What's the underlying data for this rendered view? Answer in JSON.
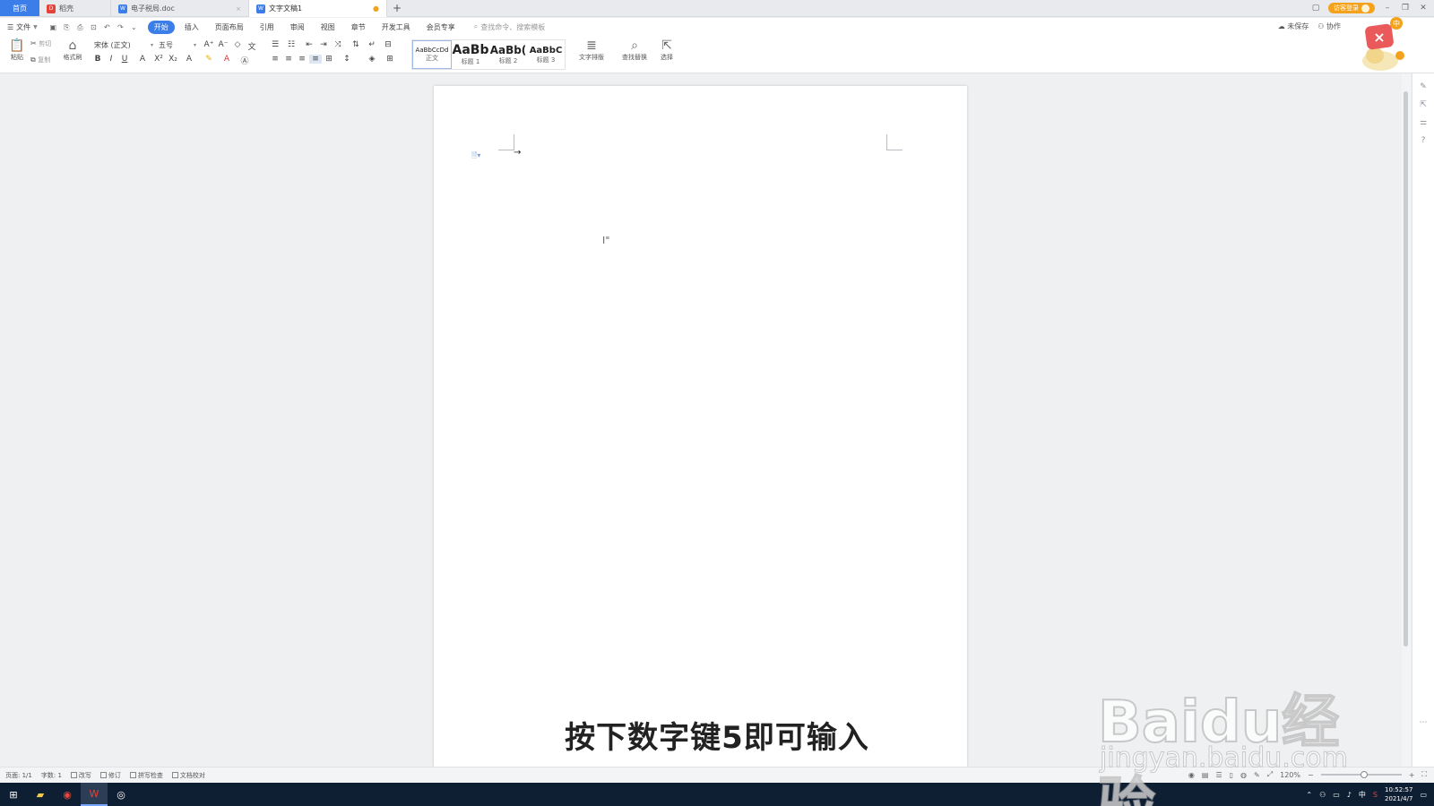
{
  "tabbar": {
    "home": "首页",
    "tabs": [
      {
        "label": "稻壳",
        "active": false
      },
      {
        "label": "电子税局.doc",
        "active": false
      },
      {
        "label": "文字文稿1",
        "active": true
      }
    ],
    "new_tab": "+",
    "login": "访客登录"
  },
  "menubar": {
    "file": "文件",
    "items": [
      "开始",
      "插入",
      "页面布局",
      "引用",
      "审阅",
      "视图",
      "章节",
      "开发工具",
      "会员专享"
    ],
    "active_index": 0,
    "search_placeholder": "查找命令、搜索模板",
    "unsaved": "未保存",
    "collab": "协作"
  },
  "ribbon": {
    "paste": "粘贴",
    "cut": "剪切",
    "copy": "复制",
    "format_painter": "格式刷",
    "font_name": "宋体 (正文)",
    "font_size": "五号",
    "styles": [
      {
        "preview": "AaBbCcDd",
        "name": "正文"
      },
      {
        "preview": "AaBb",
        "name": "标题 1"
      },
      {
        "preview": "AaBb(",
        "name": "标题 2"
      },
      {
        "preview": "AaBbC",
        "name": "标题 3"
      }
    ],
    "text_layout": "文字排版",
    "find_replace": "查找替换",
    "select": "选择"
  },
  "statusbar": {
    "page": "页面: 1/1",
    "words": "字数: 1",
    "spell": "改写",
    "revise": "修订",
    "check": "拼写检查",
    "proof": "文档校对",
    "zoom": "120%"
  },
  "taskbar": {
    "time": "10:52:57",
    "date": "2021/4/7",
    "ime": "中"
  },
  "overlay": {
    "subtitle": "按下数字键5即可输入",
    "watermark_main": "Baidu经验",
    "watermark_url": "jingyan.baidu.com"
  },
  "colors": {
    "accent": "#3b7de9",
    "taskbar": "#0f1f33",
    "login": "#f4a21b"
  }
}
